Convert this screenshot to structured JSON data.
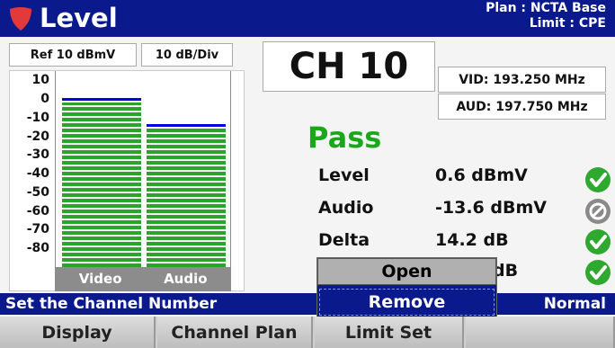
{
  "header": {
    "title": "Level",
    "plan_line": "Plan : NCTA Base",
    "limit_line": "Limit : CPE",
    "colors": {
      "background": "#0a1a8c",
      "logo": "#e23a3a"
    }
  },
  "controls": {
    "ref_level": "Ref 10 dBmV",
    "scale": "10 dB/Div"
  },
  "channel": {
    "label": "CH 10",
    "vid": "VID: 193.250 MHz",
    "aud": "AUD: 197.750 MHz"
  },
  "chart_data": {
    "type": "bar",
    "y_ticks": [
      "10",
      "0",
      "-10",
      "-20",
      "-30",
      "-40",
      "-50",
      "-60",
      "-70",
      "-80"
    ],
    "ylim": [
      -90,
      15
    ],
    "categories": [
      "Video",
      "Audio"
    ],
    "values": [
      0.6,
      -13.6
    ],
    "colors": {
      "bar": "#2aa52a",
      "peak": "#0000e0",
      "label_strip": "#8c8c8c"
    }
  },
  "result": {
    "verdict": "Pass",
    "verdict_color": "#1aa81a",
    "rows": [
      {
        "label": "Level",
        "value": "0.6 dBmV",
        "status": "pass-icon"
      },
      {
        "label": "Audio",
        "value": "-13.6 dBmV",
        "status": "disabled-icon"
      },
      {
        "label": "Delta",
        "value": "14.2 dB",
        "status": "pass-icon"
      },
      {
        "label": "",
        "value": "dB",
        "status": "pass-icon"
      }
    ]
  },
  "statusbar": {
    "hint": "Set the Channel Number",
    "mode": "Normal"
  },
  "popup": {
    "open_label": "Open",
    "remove_label": "Remove"
  },
  "softkeys": [
    "Display",
    "Channel Plan",
    "Limit Set",
    ""
  ]
}
